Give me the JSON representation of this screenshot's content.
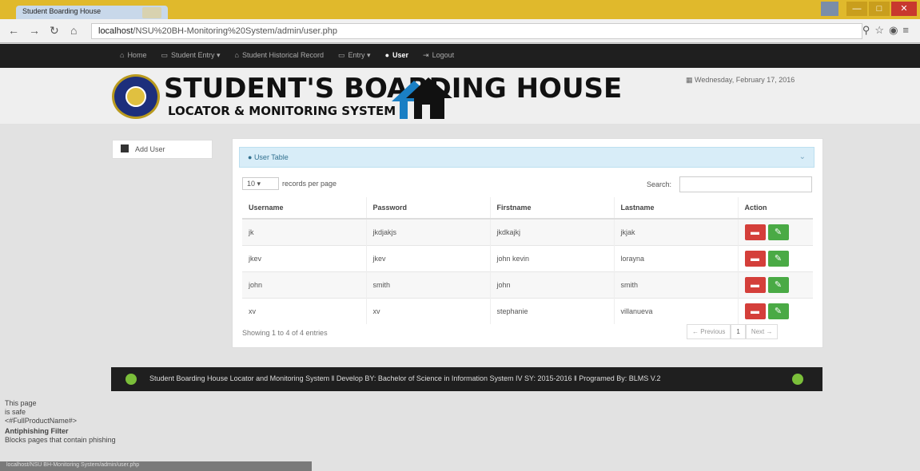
{
  "browser": {
    "tab_title": "Student Boarding House",
    "tab_close": "×",
    "url_host": "localhost",
    "url_path": "/NSU%20BH-Monitoring%20System/admin/user.php",
    "window_buttons": [
      "—",
      "□",
      "✕"
    ],
    "status_url": "localhost/NSU BH-Monitoring System/admin/user.php"
  },
  "nav": {
    "items": [
      {
        "icon": "home-icon",
        "label": "Home"
      },
      {
        "icon": "folder-icon",
        "label": "Student Entry ▾"
      },
      {
        "icon": "home-icon",
        "label": "Student Historical Record"
      },
      {
        "icon": "folder-icon",
        "label": "Entry ▾"
      },
      {
        "icon": "user-icon",
        "label": "User"
      },
      {
        "icon": "logout-icon",
        "label": "Logout"
      }
    ]
  },
  "header": {
    "title": "STUDENT'S BOARDING HOUSE",
    "subtitle": "LOCATOR & MONITORING SYSTEM",
    "date": "Wednesday, February 17, 2016"
  },
  "sidebar": {
    "add_user": "Add User"
  },
  "panel": {
    "title": "User Table",
    "length_value": "10",
    "length_suffix": "records per page",
    "search_label": "Search:",
    "columns": [
      "Username",
      "Password",
      "Firstname",
      "Lastname",
      "Action"
    ],
    "rows": [
      {
        "username": "jk",
        "password": "jkdjakjs",
        "firstname": "jkdkajkj",
        "lastname": "jkjak"
      },
      {
        "username": "jkev",
        "password": "jkev",
        "firstname": "john kevin",
        "lastname": "lorayna"
      },
      {
        "username": "john",
        "password": "smith",
        "firstname": "john",
        "lastname": "smith"
      },
      {
        "username": "xv",
        "password": "xv",
        "firstname": "stephanie",
        "lastname": "villanueva"
      }
    ],
    "info": "Showing 1 to 4 of 4 entries",
    "pager": {
      "prev": "← Previous",
      "page": "1",
      "next": "Next →"
    }
  },
  "footer": {
    "text": "Student Boarding House Locator and Monitoring System  ‖  Develop BY: Bachelor of Science in Information System IV SY: 2015-2016  ‖  Programed By: BLMS V.2"
  },
  "overlay": {
    "line1": "This page",
    "line2": "is safe",
    "line3": "<#FullProductName#>",
    "line4": "Antiphishing Filter",
    "line5": "Blocks pages that contain phishing"
  },
  "colors": {
    "navbar": "#1f1f1f",
    "panel_heading": "#d8edf8",
    "delete": "#d43f3a",
    "edit": "#4aaa45"
  }
}
